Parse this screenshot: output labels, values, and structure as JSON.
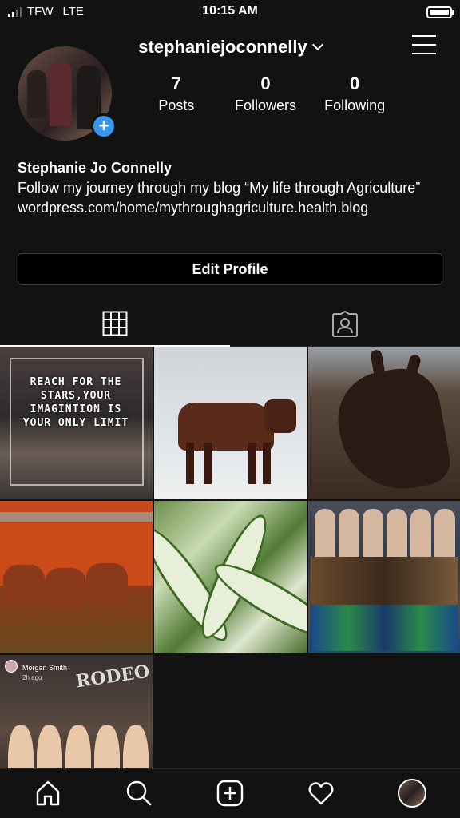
{
  "status_bar": {
    "carrier": "TFW",
    "network": "LTE",
    "time": "10:15 AM"
  },
  "header": {
    "username": "stephaniejoconnelly"
  },
  "profile": {
    "avatar_icon": "profile-photo",
    "stats": [
      {
        "value": "7",
        "label": "Posts"
      },
      {
        "value": "0",
        "label": "Followers"
      },
      {
        "value": "0",
        "label": "Following"
      }
    ],
    "full_name": "Stephanie Jo Connelly",
    "bio": "Follow my journey through my blog “My life through Agriculture”",
    "link": "wordpress.com/home/mythroughagriculture.health.blog",
    "edit_button": "Edit Profile"
  },
  "tabs": [
    {
      "icon": "grid-icon"
    },
    {
      "icon": "tagged-icon"
    }
  ],
  "posts": {
    "quote_text": "REACH FOR THE STARS,YOUR IMAGINTION IS YOUR ONLY LIMIT",
    "story_username": "Morgan Smith",
    "story_time": "2h ago",
    "story_sign": "RODEO"
  },
  "bottom_nav": [
    {
      "icon": "home-icon"
    },
    {
      "icon": "search-icon"
    },
    {
      "icon": "new-post-icon"
    },
    {
      "icon": "heart-icon"
    },
    {
      "icon": "profile-avatar"
    }
  ],
  "colors": {
    "background": "#121212",
    "accent_blue": "#3897f0",
    "text": "#ffffff"
  }
}
